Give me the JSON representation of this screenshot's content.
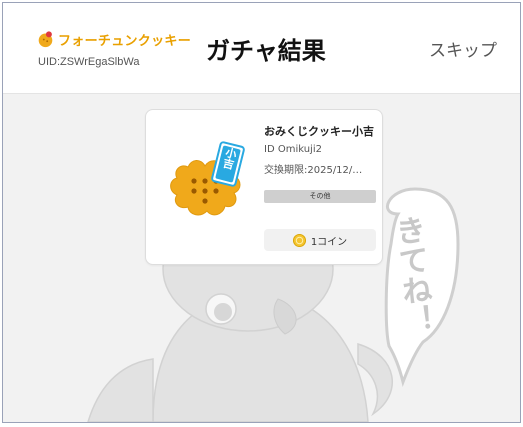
{
  "header": {
    "logo_text": "フォーチュンクッキー",
    "uid": "UID:ZSWrEgaSlbWa",
    "title": "ガチャ結果",
    "skip_label": "スキップ"
  },
  "result_card": {
    "badge_text": "小吉",
    "name": "おみくじクッキー小吉",
    "id": "ID Omikuji2",
    "expiry": "交換期限:2025/12/…",
    "category": "その他",
    "price": "1コイン"
  },
  "mascot": {
    "speech_text": "きてね！"
  },
  "colors": {
    "brand": "#e9a000",
    "cookie": "#f0a91b",
    "background": "#f2f2f2",
    "ticket": "#29a9e1"
  },
  "icons": [
    "fortune-cookie-logo-icon",
    "coin-icon"
  ]
}
